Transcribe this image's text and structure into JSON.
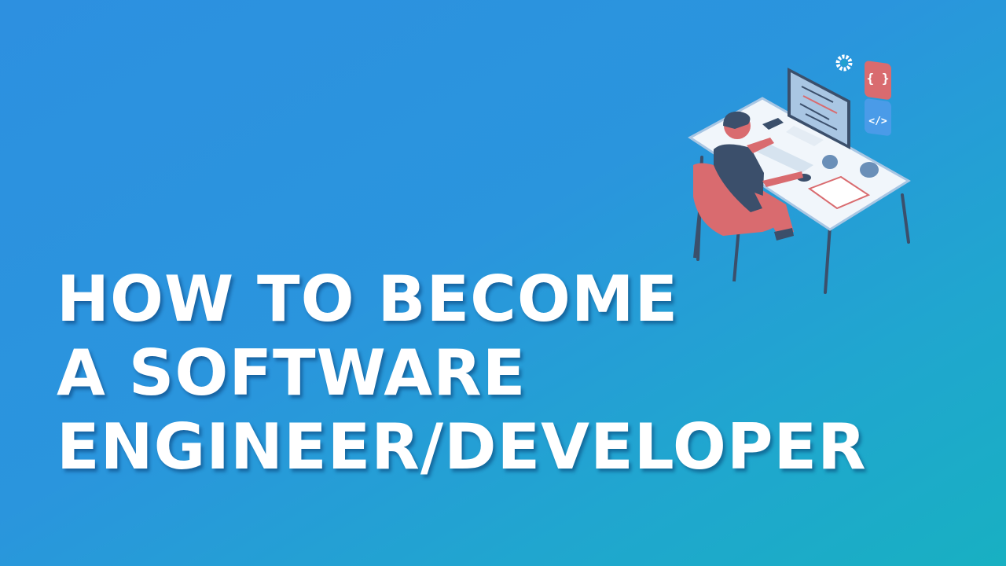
{
  "headline": {
    "lines": [
      "HOW TO BECOME",
      "A SOFTWARE",
      "ENGINEER/DEVELOPER"
    ]
  },
  "illustration": {
    "subject": "developer-at-desk",
    "icons": [
      "gear-icon",
      "curly-braces-icon",
      "code-tag-icon"
    ],
    "icon_text": {
      "braces": "{ }",
      "code": "</>"
    }
  },
  "colors": {
    "background_start": "#2d90e0",
    "background_end": "#18b0c2",
    "text": "#ffffff",
    "accent_red": "#d96b6f",
    "dark_navy": "#3b4f6b",
    "desk": "#f1f6fb"
  }
}
